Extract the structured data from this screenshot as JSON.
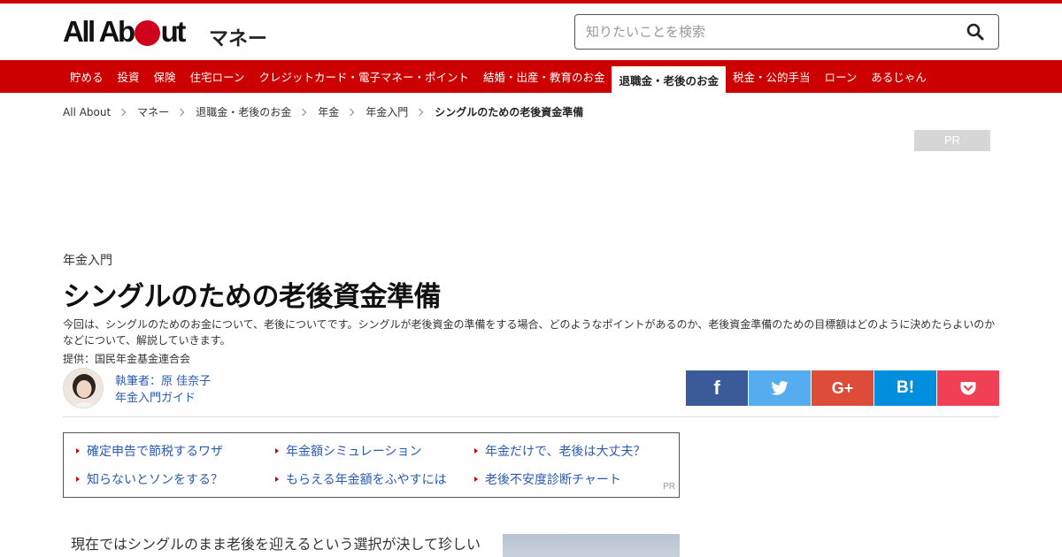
{
  "header": {
    "logo_text_a": "All",
    "logo_text_b": "Ab",
    "logo_text_c": "ut",
    "section_name": "マネー",
    "search_placeholder": "知りたいことを検索"
  },
  "nav": {
    "items": [
      {
        "label": "貯める"
      },
      {
        "label": "投資"
      },
      {
        "label": "保険"
      },
      {
        "label": "住宅ローン"
      },
      {
        "label": "クレジットカード・電子マネー・ポイント"
      },
      {
        "label": "結婚・出産・教育のお金"
      },
      {
        "label": "退職金・老後のお金"
      },
      {
        "label": "税金・公的手当"
      },
      {
        "label": "ローン"
      },
      {
        "label": "あるじゃん"
      }
    ],
    "active_index": 6
  },
  "breadcrumb": [
    {
      "label": "All About"
    },
    {
      "label": "マネー"
    },
    {
      "label": "退職金・老後のお金"
    },
    {
      "label": "年金"
    },
    {
      "label": "年金入門"
    },
    {
      "label": "シングルのための老後資金準備"
    }
  ],
  "pr_badge": "PR",
  "article": {
    "category": "年金入門",
    "title": "シングルのための老後資金準備",
    "lead": "今回は、シングルのためのお金について、老後についてです。シングルが老後資金の準備をする場合、どのようなポイントがあるのか、老後資金準備のための目標額はどのように決めたらよいのかなどについて、解説していきます。",
    "provider": "提供：国民年金基金連合会",
    "author_name": "執筆者：原 佳奈子",
    "author_guide": "年金入門ガイド",
    "body_first_line": "現在ではシングルのまま老後を迎えるという選択が決して珍しい"
  },
  "share": {
    "facebook": "f",
    "googleplus": "G+",
    "hatena": "B!"
  },
  "pr_links": {
    "items": [
      {
        "label": "確定申告で節税するワザ"
      },
      {
        "label": "年金額シミュレーション"
      },
      {
        "label": "年金だけで、老後は大丈夫？"
      },
      {
        "label": "知らないとソンをする？"
      },
      {
        "label": "もらえる年金額をふやすには"
      },
      {
        "label": "老後不安度診断チャート"
      }
    ],
    "tag": "PR"
  },
  "colors": {
    "brand_red": "#cc0000",
    "link_blue": "#2a5bb0",
    "facebook": "#3b5a9a",
    "twitter": "#55acee",
    "googleplus": "#dd4b39",
    "hatena": "#008fde",
    "pocket": "#ef4056"
  }
}
